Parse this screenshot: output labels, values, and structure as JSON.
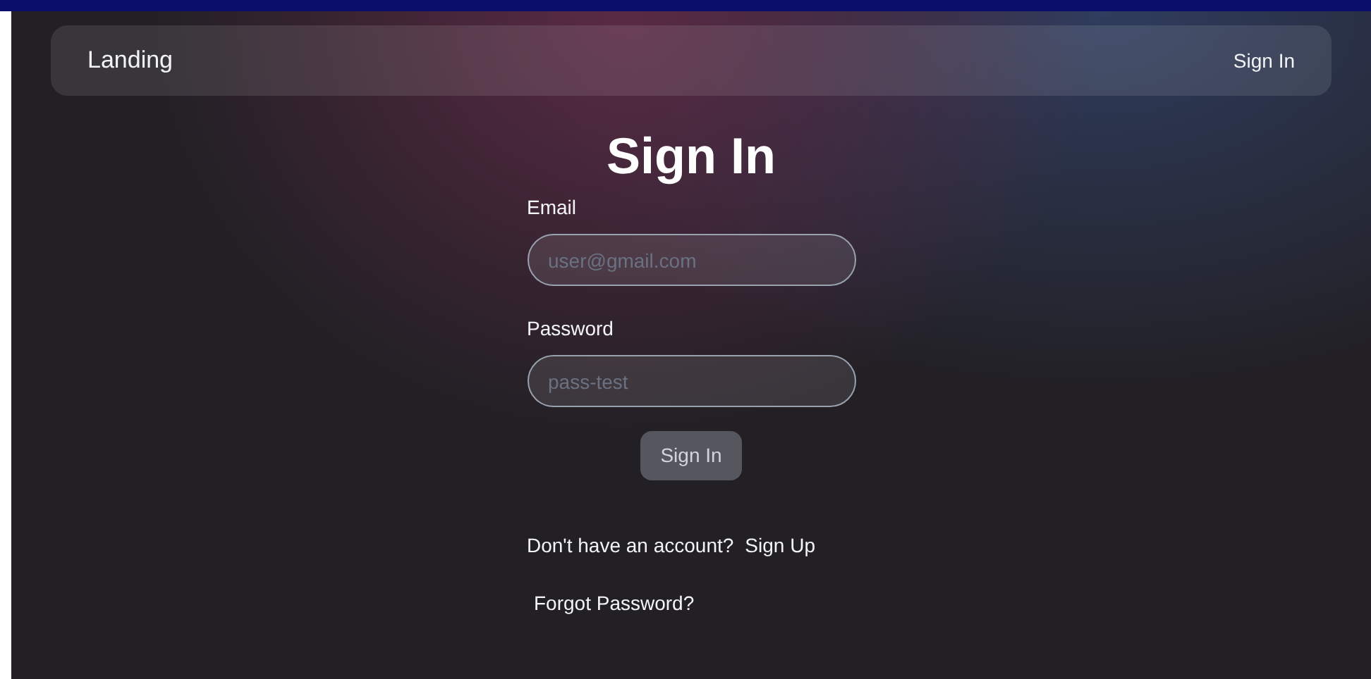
{
  "navbar": {
    "brand": "Landing",
    "link": "Sign In"
  },
  "title": "Sign In",
  "fields": [
    {
      "label": "Email",
      "placeholder": "user@gmail.com"
    },
    {
      "label": "Password",
      "placeholder": "pass-test"
    }
  ],
  "submit": {
    "label": "Sign In",
    "disabled": true
  },
  "signup": {
    "prompt": "Don't have an account?",
    "link": "Sign Up"
  },
  "forgot": "Forgot Password?"
}
